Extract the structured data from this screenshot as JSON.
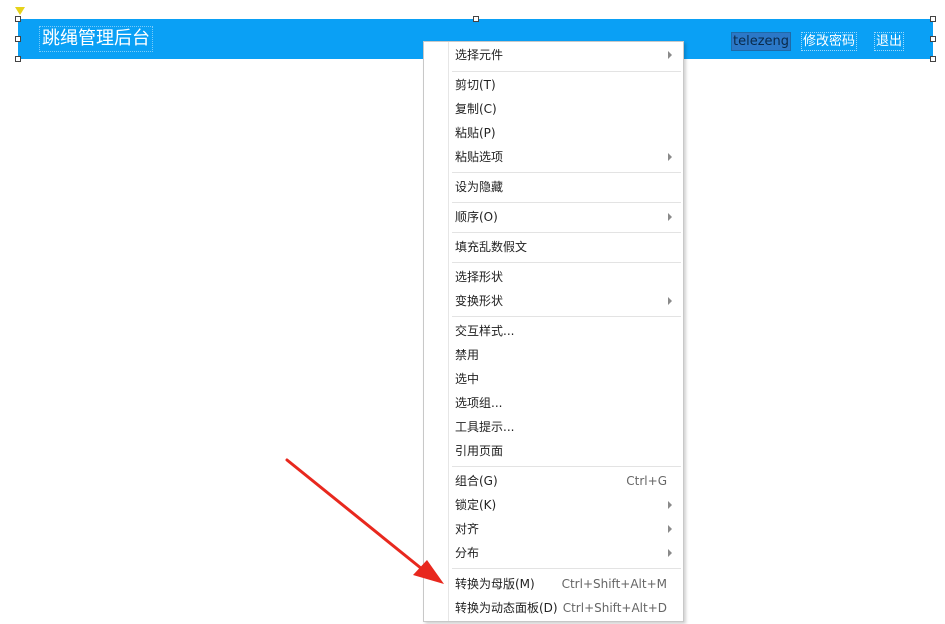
{
  "header": {
    "title": "跳绳管理后台",
    "user_link": "telezeng",
    "change_password_link": "修改密码",
    "logout_link": "退出",
    "background_color": "#0aa0f5"
  },
  "context_menu": {
    "items": [
      {
        "label": "选择元件",
        "shortcut": "",
        "has_submenu": true
      },
      {
        "label": "剪切(T)",
        "shortcut": "",
        "has_submenu": false
      },
      {
        "label": "复制(C)",
        "shortcut": "",
        "has_submenu": false
      },
      {
        "label": "粘贴(P)",
        "shortcut": "",
        "has_submenu": false
      },
      {
        "label": "粘贴选项",
        "shortcut": "",
        "has_submenu": true
      },
      {
        "label": "设为隐藏",
        "shortcut": "",
        "has_submenu": false
      },
      {
        "label": "顺序(O)",
        "shortcut": "",
        "has_submenu": true
      },
      {
        "label": "填充乱数假文",
        "shortcut": "",
        "has_submenu": false
      },
      {
        "label": "选择形状",
        "shortcut": "",
        "has_submenu": false
      },
      {
        "label": "变换形状",
        "shortcut": "",
        "has_submenu": true
      },
      {
        "label": "交互样式...",
        "shortcut": "",
        "has_submenu": false
      },
      {
        "label": "禁用",
        "shortcut": "",
        "has_submenu": false
      },
      {
        "label": "选中",
        "shortcut": "",
        "has_submenu": false
      },
      {
        "label": "选项组...",
        "shortcut": "",
        "has_submenu": false
      },
      {
        "label": "工具提示...",
        "shortcut": "",
        "has_submenu": false
      },
      {
        "label": "引用页面",
        "shortcut": "",
        "has_submenu": false
      },
      {
        "label": "组合(G)",
        "shortcut": "Ctrl+G",
        "has_submenu": false
      },
      {
        "label": "锁定(K)",
        "shortcut": "",
        "has_submenu": true
      },
      {
        "label": "对齐",
        "shortcut": "",
        "has_submenu": true
      },
      {
        "label": "分布",
        "shortcut": "",
        "has_submenu": true
      },
      {
        "label": "转换为母版(M)",
        "shortcut": "Ctrl+Shift+Alt+M",
        "has_submenu": false
      },
      {
        "label": "转换为动态面板(D)",
        "shortcut": "Ctrl+Shift+Alt+D",
        "has_submenu": false
      }
    ]
  },
  "annotation": {
    "arrow_color": "#e8281e"
  }
}
